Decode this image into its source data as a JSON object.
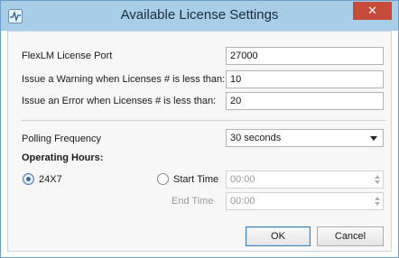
{
  "window": {
    "title": "Available License Settings",
    "close_label": "✕"
  },
  "form": {
    "port_label": "FlexLM License Port",
    "port_value": "27000",
    "warning_label": "Issue a Warning when Licenses # is less than:",
    "warning_value": "10",
    "error_label": "Issue an Error when Licenses # is less than:",
    "error_value": "20",
    "polling_label": "Polling Frequency",
    "polling_value": "30 seconds",
    "operating_hours_label": "Operating Hours:",
    "option_24x7": "24X7",
    "option_24x7_checked": true,
    "start_time_label": "Start Time",
    "start_time_value": "00:00",
    "start_time_checked": false,
    "end_time_label": "End Time",
    "end_time_value": "00:00"
  },
  "buttons": {
    "ok": "OK",
    "cancel": "Cancel"
  },
  "colors": {
    "titlebar": "#a8cde6",
    "close": "#c74b3b",
    "radio_accent": "#2a6fb8"
  },
  "icons": {
    "app": "pulse-window-icon",
    "close": "close-icon",
    "dropdown": "chevron-down-icon"
  }
}
